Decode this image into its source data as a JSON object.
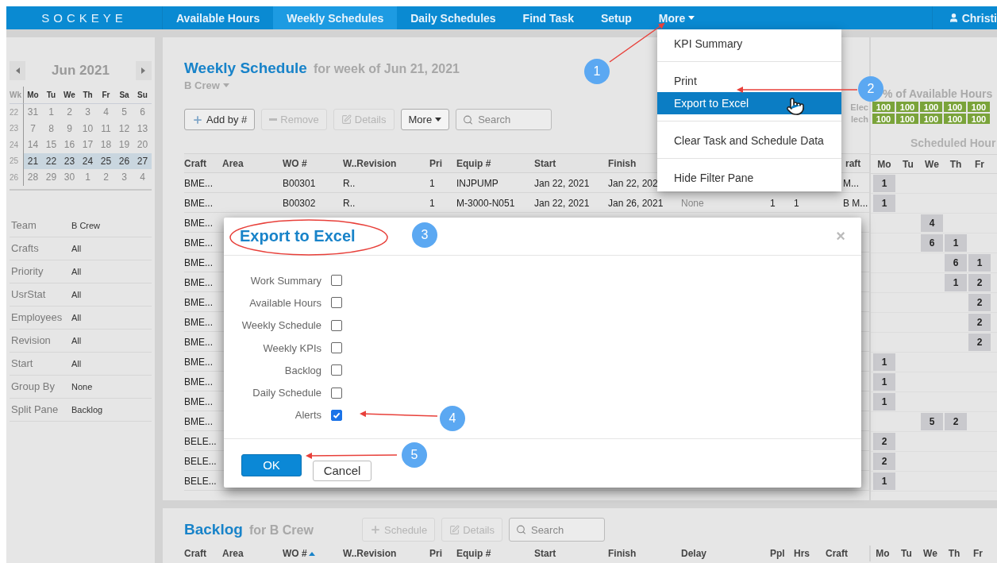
{
  "nav": {
    "logo": "SOCKEYE",
    "tabs": [
      {
        "label": "Available Hours",
        "selected": false,
        "kind": "link"
      },
      {
        "label": "Weekly Schedules",
        "selected": true,
        "kind": "link"
      },
      {
        "label": "Daily Schedules",
        "selected": false,
        "kind": "link"
      },
      {
        "label": "Find Task",
        "selected": false,
        "kind": "link"
      },
      {
        "label": "Setup",
        "selected": false,
        "kind": "link"
      },
      {
        "label": "More",
        "selected": false,
        "kind": "menu"
      }
    ],
    "user": "Christi"
  },
  "calendar": {
    "month": "Jun 2021",
    "week_label": "Wk",
    "weekdays": [
      "Mo",
      "Tu",
      "We",
      "Th",
      "Fr",
      "Sa",
      "Su"
    ],
    "weeks": [
      {
        "number": "22",
        "days": [
          "31",
          "1",
          "2",
          "3",
          "4",
          "5",
          "6"
        ],
        "selected": false
      },
      {
        "number": "23",
        "days": [
          "7",
          "8",
          "9",
          "10",
          "11",
          "12",
          "13"
        ],
        "selected": false
      },
      {
        "number": "24",
        "days": [
          "14",
          "15",
          "16",
          "17",
          "18",
          "19",
          "20"
        ],
        "selected": false
      },
      {
        "number": "25",
        "days": [
          "21",
          "22",
          "23",
          "24",
          "25",
          "26",
          "27"
        ],
        "selected": true
      },
      {
        "number": "26",
        "days": [
          "28",
          "29",
          "30",
          "1",
          "2",
          "3",
          "4"
        ],
        "selected": false
      }
    ]
  },
  "filters": [
    {
      "label": "Team",
      "value": "B Crew"
    },
    {
      "label": "Crafts",
      "value": "All"
    },
    {
      "label": "Priority",
      "value": "All"
    },
    {
      "label": "UsrStat",
      "value": "All"
    },
    {
      "label": "Employees",
      "value": "All"
    },
    {
      "label": "Revision",
      "value": "All"
    },
    {
      "label": "Start",
      "value": "All"
    },
    {
      "label": "Group By",
      "value": "None"
    },
    {
      "label": "Split Pane",
      "value": "Backlog"
    }
  ],
  "weekly": {
    "title": "Weekly Schedule",
    "subtitle": "for week of Jun 21, 2021",
    "crew": "B Crew",
    "toolbar": [
      {
        "kind": "add",
        "label": "Add by #",
        "disabled": false
      },
      {
        "kind": "remove",
        "label": "Remove",
        "disabled": true
      },
      {
        "kind": "details",
        "label": "Details",
        "disabled": true
      },
      {
        "kind": "menu",
        "label": "More",
        "disabled": false
      }
    ],
    "search": {
      "placeholder": "Search"
    },
    "columns": [
      {
        "label": "Craft"
      },
      {
        "label": "Area"
      },
      {
        "label": "WO #"
      },
      {
        "label": "W..Revision"
      },
      {
        "label": "Pri"
      },
      {
        "label": "Equip #"
      },
      {
        "label": "Start"
      },
      {
        "label": "Finish"
      },
      {},
      {},
      {},
      {
        "label": "raft"
      }
    ],
    "rows": [
      {
        "cells": [
          "BME...",
          null,
          "B00301",
          "R..",
          "1",
          "INJPUMP",
          "Jan 22, 2021",
          "Jan 22, 202",
          null,
          null,
          null,
          "M..."
        ]
      },
      {
        "cells": [
          "BME...",
          null,
          "B00302",
          "R..",
          "1",
          "M-3000-N051",
          "Jan 22, 2021",
          "Jan 26, 2021",
          "None",
          "1",
          "1",
          "B M..."
        ]
      },
      {
        "cells": [
          "BME..."
        ]
      },
      {
        "cells": [
          "BME..."
        ]
      },
      {
        "cells": [
          "BME..."
        ]
      },
      {
        "cells": [
          "BME..."
        ]
      },
      {
        "cells": [
          "BME..."
        ]
      },
      {
        "cells": [
          "BME..."
        ]
      },
      {
        "cells": [
          "BME..."
        ]
      },
      {
        "cells": [
          "BME..."
        ]
      },
      {
        "cells": [
          "BME..."
        ]
      },
      {
        "cells": [
          "BME..."
        ]
      },
      {
        "cells": [
          "BME..."
        ]
      },
      {
        "cells": [
          "BELE..."
        ]
      },
      {
        "cells": [
          "BELE..."
        ]
      },
      {
        "cells": [
          "BELE..."
        ]
      }
    ]
  },
  "hours": {
    "title": "% of Available Hours",
    "rows": [
      {
        "label": "Elec",
        "values": [
          "100",
          "100",
          "100",
          "100",
          "100"
        ]
      },
      {
        "label": "lech",
        "values": [
          "100",
          "100",
          "100",
          "100",
          "100"
        ]
      }
    ]
  },
  "scheduled": {
    "title": "Scheduled Hour",
    "days": [
      "Mo",
      "Tu",
      "We",
      "Th",
      "Fr"
    ],
    "rows": [
      [
        "1",
        null,
        null,
        null,
        null
      ],
      [
        "1",
        null,
        null,
        null,
        null
      ],
      [
        null,
        null,
        "4",
        null,
        null
      ],
      [
        null,
        null,
        "6",
        "1",
        null
      ],
      [
        null,
        null,
        null,
        "6",
        "1"
      ],
      [
        null,
        null,
        null,
        "1",
        "2"
      ],
      [
        null,
        null,
        null,
        null,
        "2"
      ],
      [
        null,
        null,
        null,
        null,
        "2"
      ],
      [
        null,
        null,
        null,
        null,
        "2"
      ],
      [
        "1",
        null,
        null,
        null,
        null
      ],
      [
        "1",
        null,
        null,
        null,
        null
      ],
      [
        "1",
        null,
        null,
        null,
        null
      ],
      [
        null,
        null,
        "5",
        "2",
        null
      ],
      [
        "2",
        null,
        null,
        null,
        null
      ],
      [
        "2",
        null,
        null,
        null,
        null
      ],
      [
        "1",
        null,
        null,
        null,
        null
      ]
    ]
  },
  "backlog": {
    "title": "Backlog",
    "subtitle": "for B Crew",
    "toolbar": [
      {
        "kind": "add",
        "label": "Schedule",
        "disabled": true
      },
      {
        "kind": "details",
        "label": "Details",
        "disabled": true
      }
    ],
    "search": {
      "placeholder": "Search"
    },
    "columns": [
      {
        "label": "Craft",
        "sorted": false
      },
      {
        "label": "Area",
        "sorted": false
      },
      {
        "label": "WO #",
        "sorted": true
      },
      {
        "label": "W..Revision",
        "sorted": false
      },
      {
        "label": "Pri",
        "sorted": false
      },
      {
        "label": "Equip #",
        "sorted": false
      },
      {
        "label": "Start",
        "sorted": false
      },
      {
        "label": "Finish",
        "sorted": false
      },
      {
        "label": "Delay",
        "sorted": false
      },
      {
        "label": "Ppl",
        "sorted": false
      },
      {
        "label": "Hrs",
        "sorted": false
      },
      {
        "label": "Craft",
        "sorted": false
      }
    ],
    "days": [
      "Mo",
      "Tu",
      "We",
      "Th",
      "Fr"
    ]
  },
  "menu": {
    "sections": [
      [
        {
          "label": "KPI Summary",
          "selected": false
        }
      ],
      [
        {
          "label": "Print",
          "selected": false
        },
        {
          "label": "Export to Excel",
          "selected": true
        }
      ],
      [
        {
          "label": "Clear Task and Schedule Data",
          "selected": false
        }
      ],
      [
        {
          "label": "Hide Filter Pane",
          "selected": false
        }
      ]
    ]
  },
  "dialog": {
    "title": "Export to Excel",
    "close": "×",
    "options": [
      {
        "label": "Work Summary",
        "checked": false
      },
      {
        "label": "Available Hours",
        "checked": false
      },
      {
        "label": "Weekly Schedule",
        "checked": false
      },
      {
        "label": "Weekly KPIs",
        "checked": false
      },
      {
        "label": "Backlog",
        "checked": false
      },
      {
        "label": "Daily Schedule",
        "checked": false
      },
      {
        "label": "Alerts",
        "checked": true
      }
    ],
    "ok": "OK",
    "cancel": "Cancel"
  },
  "annotations": [
    {
      "number": "1"
    },
    {
      "number": "2"
    },
    {
      "number": "3"
    },
    {
      "number": "4"
    },
    {
      "number": "5"
    }
  ]
}
